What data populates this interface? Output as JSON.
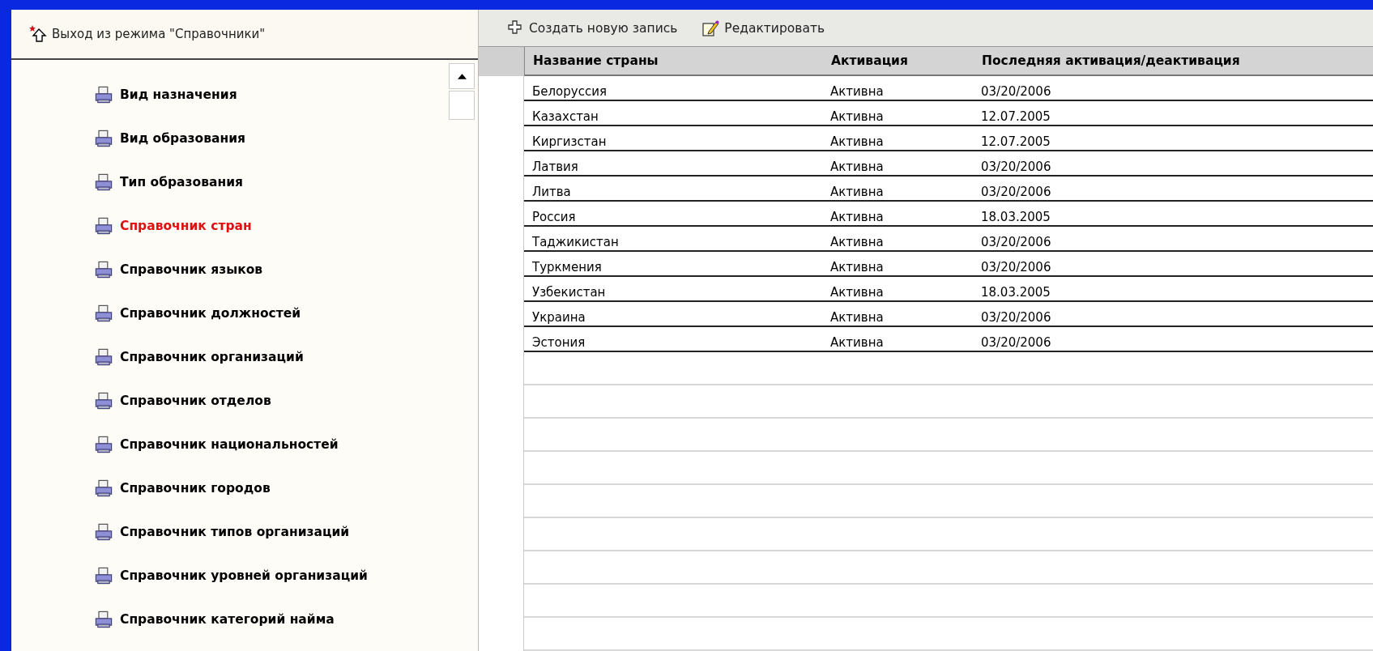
{
  "exit_button": {
    "label": "Выход из режима \"Справочники\""
  },
  "toolbar": [
    {
      "label": "Создать новую запись",
      "kind": "create"
    },
    {
      "label": "Редактировать",
      "kind": "edit"
    }
  ],
  "sidebar": {
    "items": [
      {
        "label": "Вид назначения",
        "selected": false
      },
      {
        "label": "Вид образования",
        "selected": false
      },
      {
        "label": "Тип образования",
        "selected": false
      },
      {
        "label": "Справочник стран",
        "selected": true
      },
      {
        "label": "Справочник языков",
        "selected": false
      },
      {
        "label": "Справочник должностей",
        "selected": false
      },
      {
        "label": "Справочник организаций",
        "selected": false
      },
      {
        "label": "Справочник отделов",
        "selected": false
      },
      {
        "label": "Справочник национальностей",
        "selected": false
      },
      {
        "label": "Справочник городов",
        "selected": false
      },
      {
        "label": "Справочник типов организаций",
        "selected": false
      },
      {
        "label": "Справочник уровней организаций",
        "selected": false
      },
      {
        "label": "Справочник категорий найма",
        "selected": false
      }
    ]
  },
  "table": {
    "columns": [
      "Название страны",
      "Активация",
      "Последняя активация/деактивация"
    ],
    "rows": [
      [
        "Белоруссия",
        "Активна",
        "03/20/2006"
      ],
      [
        "Казахстан",
        "Активна",
        "12.07.2005"
      ],
      [
        "Киргизстан",
        "Активна",
        "12.07.2005"
      ],
      [
        "Латвия",
        "Активна",
        "03/20/2006"
      ],
      [
        "Литва",
        "Активна",
        "03/20/2006"
      ],
      [
        "Россия",
        "Активна",
        "18.03.2005"
      ],
      [
        "Таджикистан",
        "Активна",
        "03/20/2006"
      ],
      [
        "Туркмения",
        "Активна",
        "03/20/2006"
      ],
      [
        "Узбекистан",
        "Активна",
        "18.03.2005"
      ],
      [
        "Украина",
        "Активна",
        "03/20/2006"
      ],
      [
        "Эстония",
        "Активна",
        "03/20/2006"
      ]
    ]
  }
}
